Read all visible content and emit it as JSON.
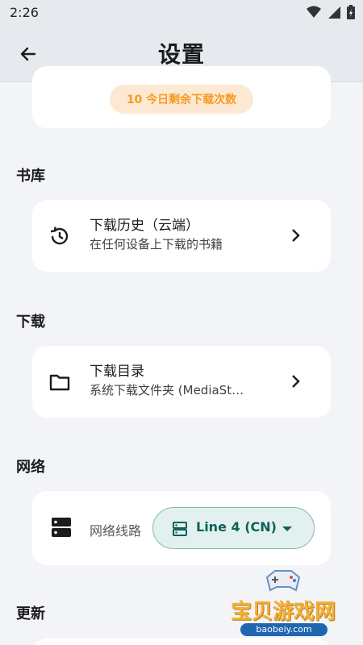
{
  "status_bar": {
    "time": "2:26"
  },
  "app_bar": {
    "title": "设置"
  },
  "quota": {
    "text": "10 今日剩余下载次数"
  },
  "sections": {
    "library": "书库",
    "download": "下载",
    "network": "网络",
    "update": "更新"
  },
  "library_row": {
    "title": "下载历史（云端）",
    "subtitle": "在任何设备上下载的书籍",
    "icon": "history-icon"
  },
  "download_row": {
    "title": "下载目录",
    "subtitle": "系统下载文件夹 (MediaSt…",
    "icon": "folder-icon"
  },
  "network_row": {
    "label": "网络线路",
    "selected": "Line 4 (CN)",
    "icon": "server-icon"
  },
  "watermark": {
    "text": "宝贝游戏网",
    "url": "baobeiy.com"
  },
  "colors": {
    "accent": "#11605a",
    "quota_text": "#f59a23",
    "quota_bg": "#fde9d3",
    "background": "#f2f4f7"
  }
}
